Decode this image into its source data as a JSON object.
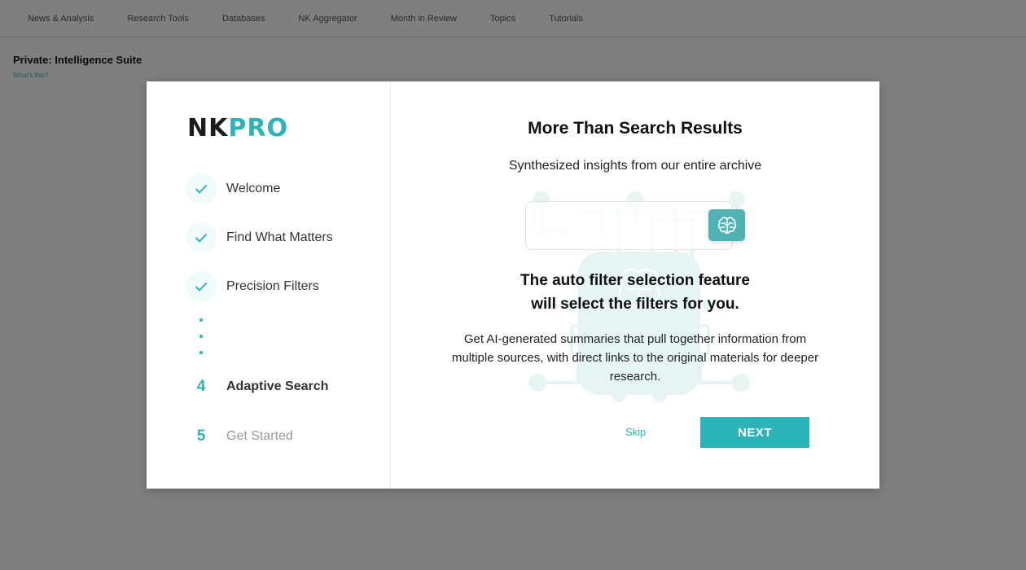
{
  "background": {
    "nav_items": [
      "News & Analysis",
      "Research Tools",
      "Databases",
      "NK Aggregator",
      "Month in Review",
      "Topics",
      "Tutorials"
    ],
    "page_title": "Private: Intelligence Suite",
    "page_subtitle": "What's this?"
  },
  "modal": {
    "logo": {
      "nk": "NK",
      "pro": "PRO"
    },
    "steps": [
      {
        "label": "Welcome",
        "status": "done"
      },
      {
        "label": "Find What Matters",
        "status": "done"
      },
      {
        "label": "Precision Filters",
        "status": "done"
      },
      {
        "number": "4",
        "label": "Adaptive Search",
        "status": "active"
      },
      {
        "number": "5",
        "label": "Get Started",
        "status": "pending"
      }
    ],
    "heading": "More Than Search Results",
    "subheading": "Synthesized insights from our entire archive",
    "feature_line1": "The auto filter selection feature",
    "feature_line2": "will select the filters for you.",
    "description": "Get AI-generated summaries that pull together information from multiple sources, with direct links to the original materials for deeper research.",
    "skip_label": "Skip",
    "next_label": "NEXT"
  },
  "colors": {
    "accent": "#2bb5b8",
    "overlay": "rgba(0,0,0,0.5)"
  },
  "icons": {
    "ai_button": "brain-icon",
    "step_done": "check-icon"
  }
}
